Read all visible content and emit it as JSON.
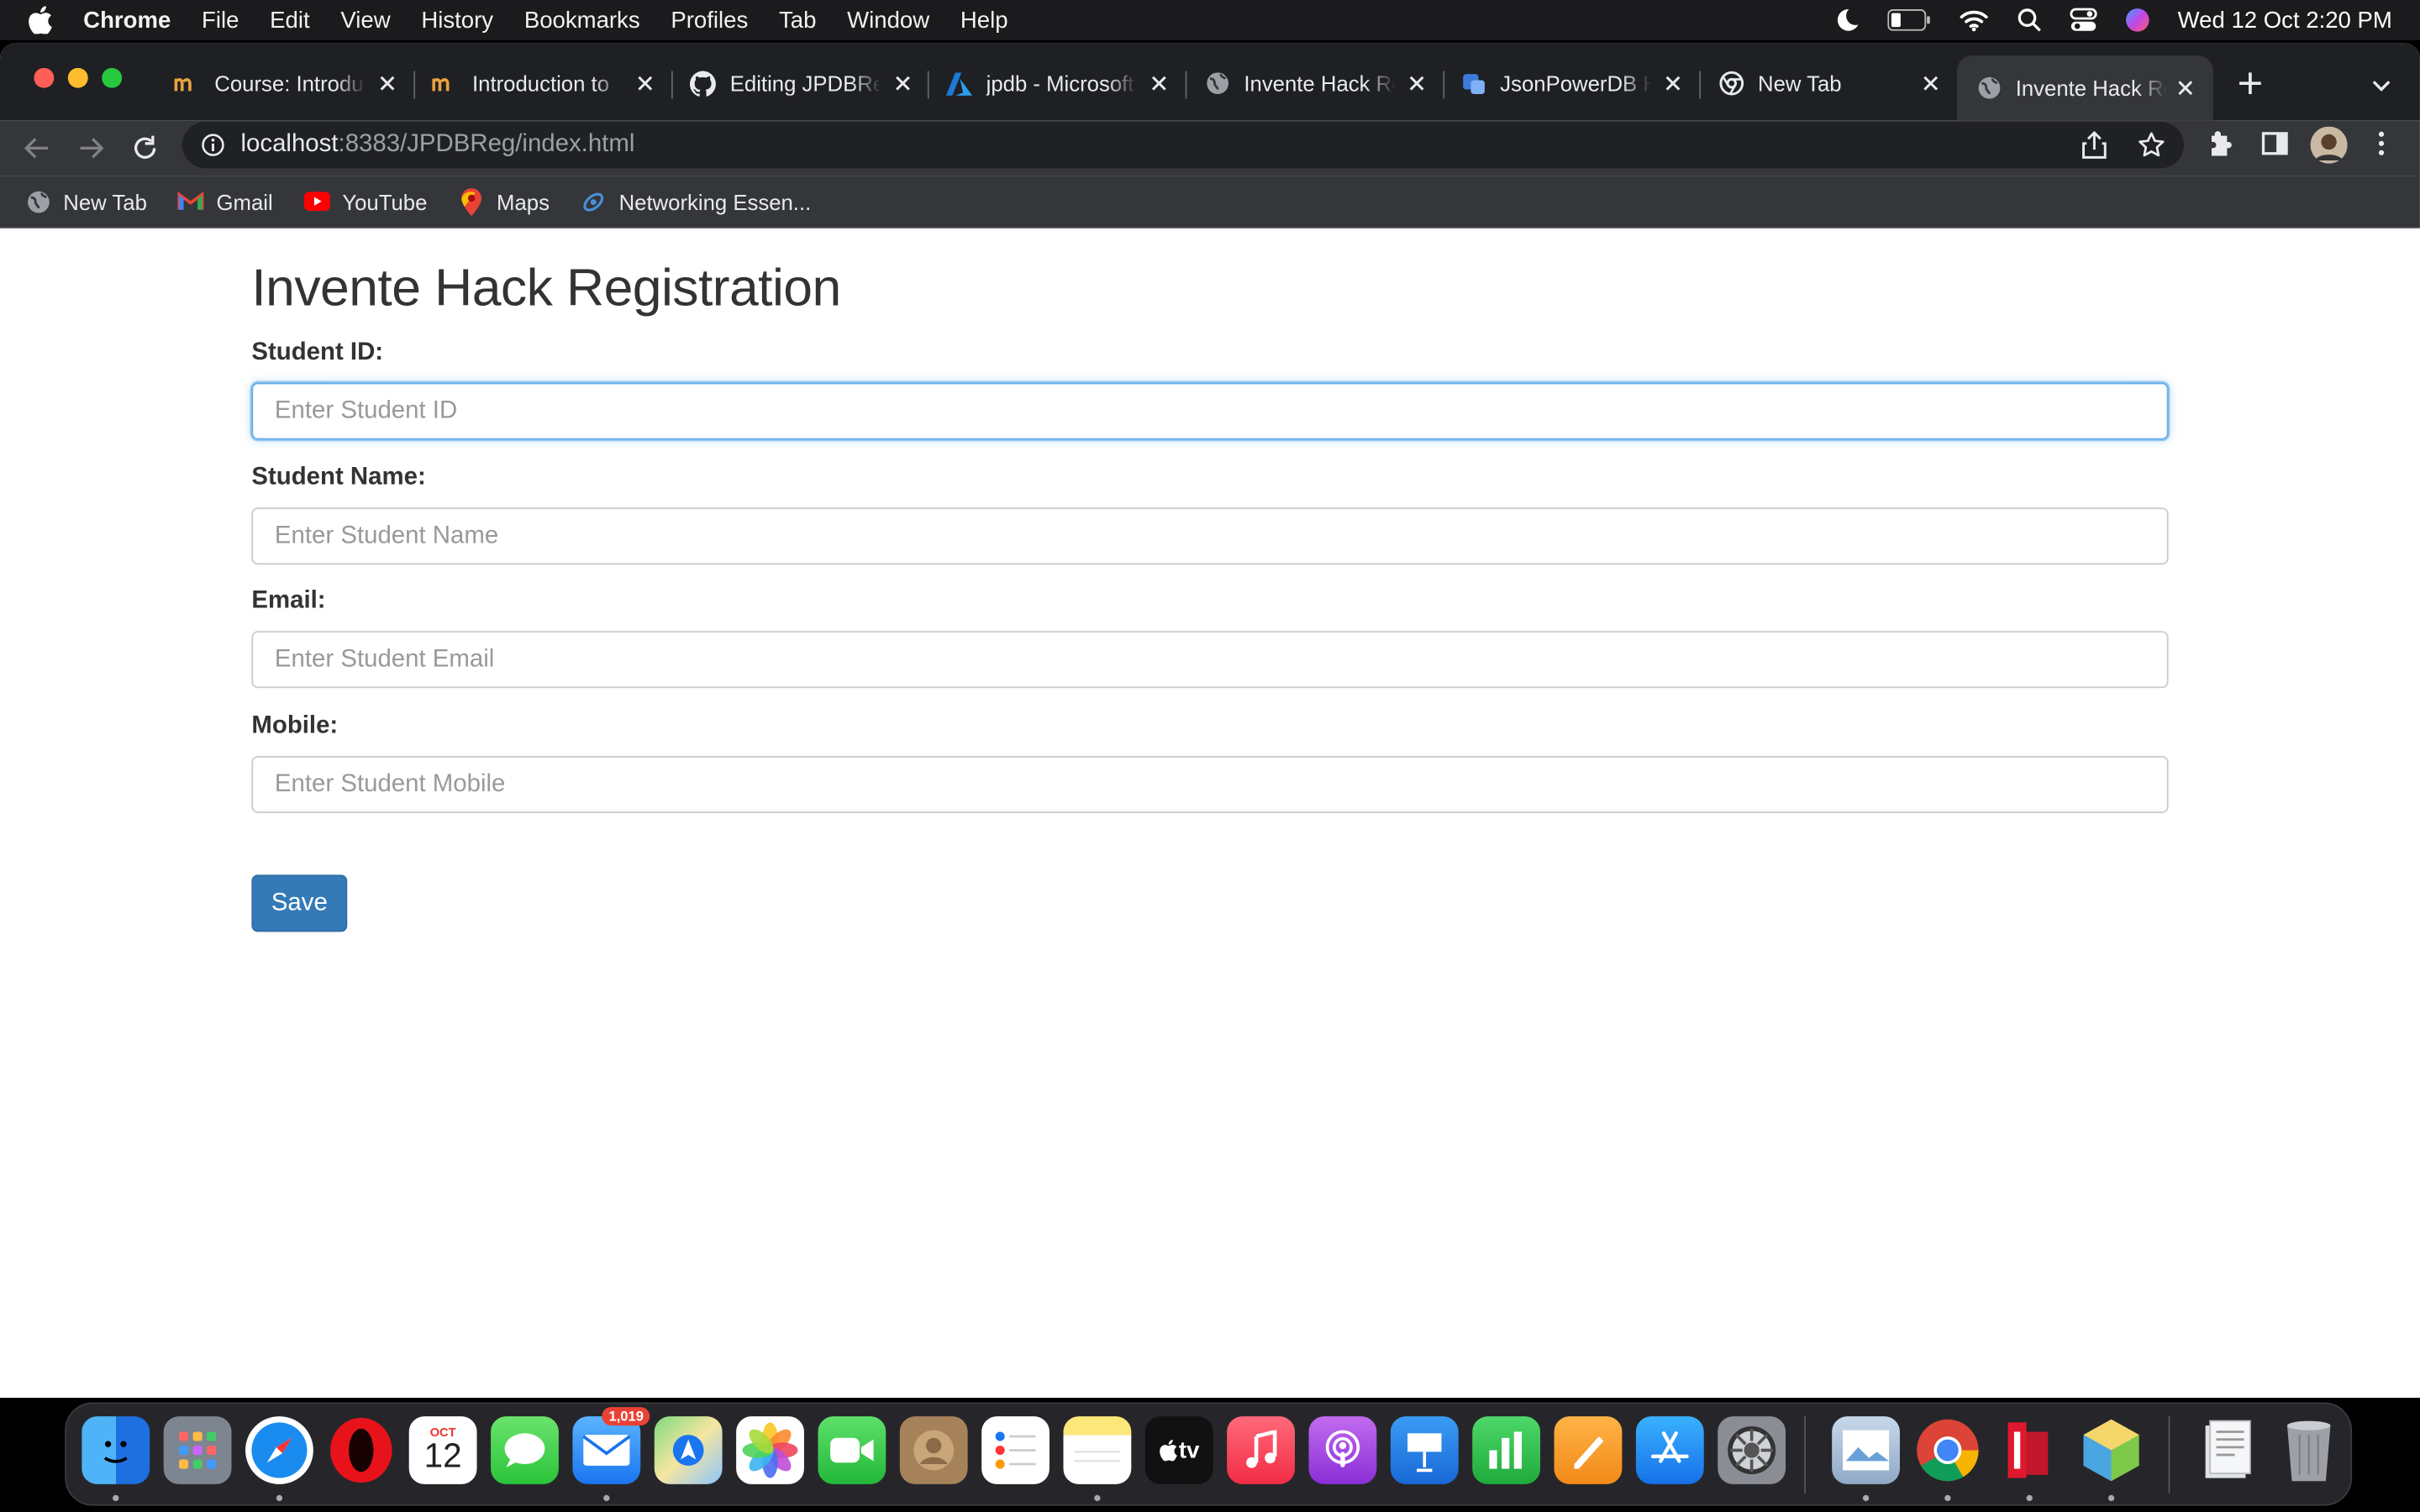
{
  "menubar": {
    "app_name": "Chrome",
    "items": [
      "File",
      "Edit",
      "View",
      "History",
      "Bookmarks",
      "Profiles",
      "Tab",
      "Window",
      "Help"
    ],
    "clock": "Wed 12 Oct  2:20 PM"
  },
  "tabs": [
    {
      "title": "Course: Introdu",
      "icon": "nptel-icon"
    },
    {
      "title": "Introduction to",
      "icon": "nptel-icon"
    },
    {
      "title": "Editing JPDBRe",
      "icon": "github-icon"
    },
    {
      "title": "jpdb - Microsoft",
      "icon": "azure-icon"
    },
    {
      "title": "Invente Hack Re",
      "icon": "globe-icon"
    },
    {
      "title": "JsonPowerDB H",
      "icon": "jpdb-icon"
    },
    {
      "title": "New Tab",
      "icon": "chrome-icon"
    },
    {
      "title": "Invente Hack Re",
      "icon": "globe-icon",
      "active": true
    }
  ],
  "address": {
    "host": "localhost",
    "path": ":8383/JPDBReg/index.html"
  },
  "bookmarks": [
    {
      "label": "New Tab",
      "icon": "globe-icon"
    },
    {
      "label": "Gmail",
      "icon": "gmail-icon"
    },
    {
      "label": "YouTube",
      "icon": "youtube-icon"
    },
    {
      "label": "Maps",
      "icon": "maps-icon"
    },
    {
      "label": "Networking Essen...",
      "icon": "cisco-icon"
    }
  ],
  "form": {
    "title": "Invente Hack Registration",
    "student_id": {
      "label": "Student ID:",
      "placeholder": "Enter Student ID"
    },
    "student_name": {
      "label": "Student Name:",
      "placeholder": "Enter Student Name"
    },
    "email": {
      "label": "Email:",
      "placeholder": "Enter Student Email"
    },
    "mobile": {
      "label": "Mobile:",
      "placeholder": "Enter Student Mobile"
    },
    "save_label": "Save"
  },
  "dock": {
    "calendar_month": "OCT",
    "calendar_day": "12",
    "mail_badge": "1,019",
    "tv_label": "tv"
  },
  "colors": {
    "primary_button": "#337ab7",
    "focus_border": "#66afe9",
    "tab_strip": "#1f2023",
    "toolbar": "#35363a"
  }
}
